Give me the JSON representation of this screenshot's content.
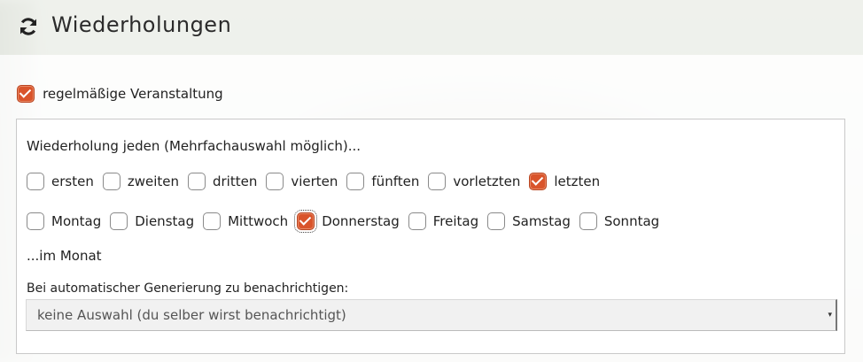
{
  "header": {
    "title": "Wiederholungen",
    "icon": "refresh-icon"
  },
  "main_checkbox": {
    "label": "regelmäßige Veranstaltung",
    "checked": true
  },
  "repeat": {
    "heading": "Wiederholung jeden (Mehrfachauswahl möglich)...",
    "ordinals": [
      {
        "label": "ersten",
        "checked": false
      },
      {
        "label": "zweiten",
        "checked": false
      },
      {
        "label": "dritten",
        "checked": false
      },
      {
        "label": "vierten",
        "checked": false
      },
      {
        "label": "fünften",
        "checked": false
      },
      {
        "label": "vorletzten",
        "checked": false
      },
      {
        "label": "letzten",
        "checked": true
      }
    ],
    "weekdays": [
      {
        "label": "Montag",
        "checked": false
      },
      {
        "label": "Dienstag",
        "checked": false
      },
      {
        "label": "Mittwoch",
        "checked": false
      },
      {
        "label": "Donnerstag",
        "checked": true
      },
      {
        "label": "Freitag",
        "checked": false
      },
      {
        "label": "Samstag",
        "checked": false
      },
      {
        "label": "Sonntag",
        "checked": false
      }
    ],
    "month_suffix": "...im Monat"
  },
  "notify": {
    "label": "Bei automatischer Generierung zu benachrichtigen:",
    "selected": "keine Auswahl (du selber wirst benachrichtigt)"
  },
  "colors": {
    "accent": "#d9542b"
  }
}
